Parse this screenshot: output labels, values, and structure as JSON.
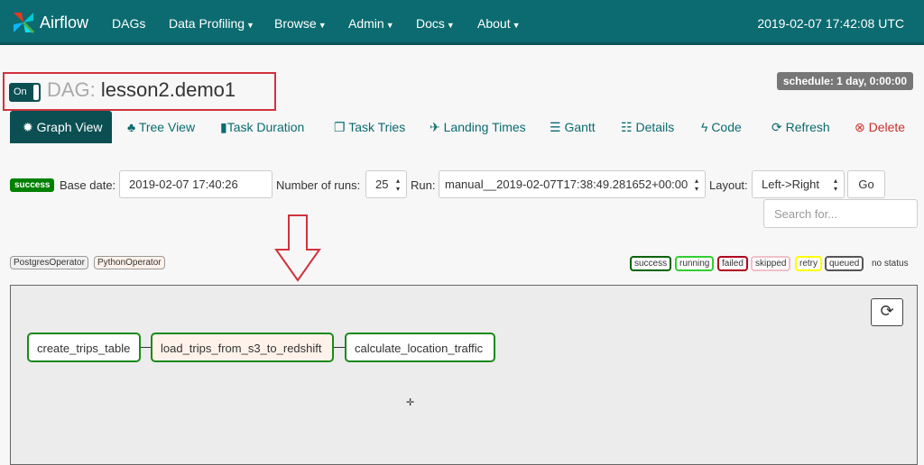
{
  "nav": {
    "brand": "Airflow",
    "items": [
      {
        "label": "DAGs",
        "caret": false
      },
      {
        "label": "Data Profiling",
        "caret": true
      },
      {
        "label": "Browse",
        "caret": true
      },
      {
        "label": "Admin",
        "caret": true
      },
      {
        "label": "Docs",
        "caret": true
      },
      {
        "label": "About",
        "caret": true
      }
    ],
    "time": "2019-02-07 17:42:08 UTC"
  },
  "dag": {
    "toggle": "On",
    "label": "DAG:",
    "name": "lesson2.demo1",
    "schedule": "schedule: 1 day, 0:00:00"
  },
  "tabs": [
    {
      "label": "Graph View",
      "icon": "asterisk-icon"
    },
    {
      "label": "Tree View",
      "icon": "tree-icon"
    },
    {
      "label": "Task Duration",
      "icon": "bar-chart-icon"
    },
    {
      "label": "Task Tries",
      "icon": "files-icon"
    },
    {
      "label": "Landing Times",
      "icon": "plane-icon"
    },
    {
      "label": "Gantt",
      "icon": "align-left-icon"
    },
    {
      "label": "Details",
      "icon": "list-icon"
    },
    {
      "label": "Code",
      "icon": "flash-icon"
    },
    {
      "label": "Refresh",
      "icon": "refresh-icon"
    },
    {
      "label": "Delete",
      "icon": "remove-circle-icon"
    }
  ],
  "form": {
    "status": "success",
    "base_date_label": "Base date:",
    "base_date": "2019-02-07 17:40:26",
    "runs_label": "Number of runs:",
    "runs": "25",
    "run_label": "Run:",
    "run": "manual__2019-02-07T17:38:49.281652+00:00",
    "layout_label": "Layout:",
    "layout": "Left->Right",
    "go": "Go",
    "search_placeholder": "Search for..."
  },
  "operators": [
    "PostgresOperator",
    "PythonOperator"
  ],
  "legend": [
    {
      "label": "success",
      "color": "#006400"
    },
    {
      "label": "running",
      "color": "#32cd32"
    },
    {
      "label": "failed",
      "color": "#b00020"
    },
    {
      "label": "skipped",
      "color": "#f0c0c8"
    },
    {
      "label": "retry",
      "color": "#ffff00"
    },
    {
      "label": "queued",
      "color": "#555555"
    }
  ],
  "no_status": "no status",
  "tasks": [
    "create_trips_table",
    "load_trips_from_s3_to_redshift",
    "calculate_location_traffic"
  ],
  "colors": {
    "nav": "#0b6b70",
    "success": "#1a8a1a",
    "highlight": "#d0333d"
  }
}
